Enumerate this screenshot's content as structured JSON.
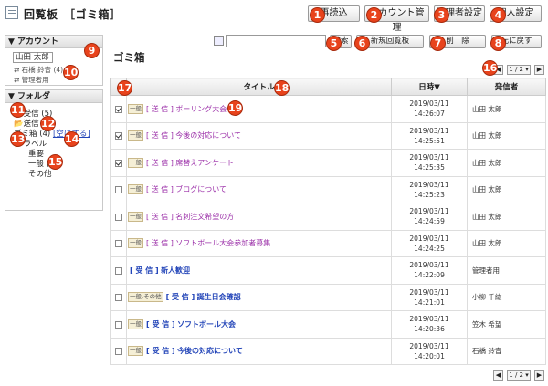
{
  "app": {
    "title": "回覧板",
    "section": "［ゴミ箱］"
  },
  "toolbar": {
    "reload": "再読込",
    "account": "アカウント管理",
    "admin": "管理者設定",
    "personal": "個人設定"
  },
  "sidebar": {
    "account_header": "▼ アカウント",
    "account_select": "山田 太郎",
    "accounts": [
      "石橋 鈴音 (4)",
      "管理者用"
    ],
    "folder_header": "▼ フォルダ",
    "folders": {
      "inbox": "受信 (5)",
      "sent": "送信",
      "trash": "ゴミ箱 (4)",
      "empty": "[空にする]",
      "label": "ラベル"
    },
    "labels": [
      "重要",
      "一般 (1)",
      "その他"
    ]
  },
  "actions": {
    "search_placeholder": "",
    "search_btn": "検索",
    "new_btn": "新規回覧板",
    "delete_btn": "削　除",
    "restore_btn": "元に戻す"
  },
  "main": {
    "heading": "ゴミ箱",
    "page": "1 / 2 ▾"
  },
  "table": {
    "headers": {
      "title": "タイトル",
      "date": "日時▼",
      "sender": "発信者"
    },
    "rows": [
      {
        "checked": true,
        "tag": "一般",
        "status": "[ 送 信 ]",
        "title": "ボーリング大会",
        "date": "2019/03/11",
        "time": "14:26:07",
        "sender": "山田 太郎",
        "recv": false
      },
      {
        "checked": true,
        "tag": "一般",
        "status": "[ 送 信 ]",
        "title": "今後の対応について",
        "date": "2019/03/11",
        "time": "14:25:51",
        "sender": "山田 太郎",
        "recv": false
      },
      {
        "checked": true,
        "tag": "一般",
        "status": "[ 送 信 ]",
        "title": "席替えアンケート",
        "date": "2019/03/11",
        "time": "14:25:35",
        "sender": "山田 太郎",
        "recv": false
      },
      {
        "checked": false,
        "tag": "一般",
        "status": "[ 送 信 ]",
        "title": "ブログについて",
        "date": "2019/03/11",
        "time": "14:25:23",
        "sender": "山田 太郎",
        "recv": false
      },
      {
        "checked": false,
        "tag": "一般",
        "status": "[ 送 信 ]",
        "title": "名刺注文希望の方",
        "date": "2019/03/11",
        "time": "14:24:59",
        "sender": "山田 太郎",
        "recv": false
      },
      {
        "checked": false,
        "tag": "一般",
        "status": "[ 送 信 ]",
        "title": "ソフトボール大会参加者募集",
        "date": "2019/03/11",
        "time": "14:24:25",
        "sender": "山田 太郎",
        "recv": false
      },
      {
        "checked": false,
        "tag": "",
        "status": "[ 受 信 ]",
        "title": "新人歓迎",
        "date": "2019/03/11",
        "time": "14:22:09",
        "sender": "管理者用",
        "recv": true
      },
      {
        "checked": false,
        "tag": "一般,その他",
        "status": "[ 受 信 ]",
        "title": "誕生日会確認",
        "date": "2019/03/11",
        "time": "14:21:01",
        "sender": "小柳 千紘",
        "recv": true
      },
      {
        "checked": false,
        "tag": "一般",
        "status": "[ 受 信 ]",
        "title": "ソフトボール大会",
        "date": "2019/03/11",
        "time": "14:20:36",
        "sender": "笠木 希望",
        "recv": true
      },
      {
        "checked": false,
        "tag": "一般",
        "status": "[ 受 信 ]",
        "title": "今後の対応について",
        "date": "2019/03/11",
        "time": "14:20:01",
        "sender": "石橋 鈴音",
        "recv": true
      }
    ]
  },
  "markers": [
    "1",
    "2",
    "3",
    "4",
    "5",
    "6",
    "7",
    "8",
    "9",
    "10",
    "11",
    "12",
    "13",
    "14",
    "15",
    "16",
    "17",
    "18",
    "19"
  ],
  "colors": {
    "marker": "#e8431c",
    "sent": "#9b2fa8",
    "received": "#2244b8"
  }
}
